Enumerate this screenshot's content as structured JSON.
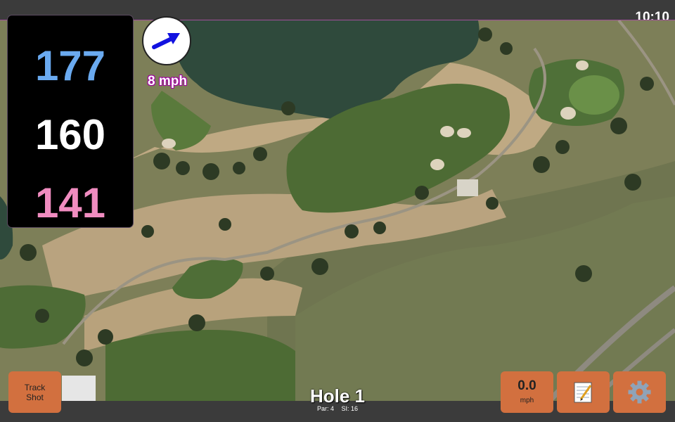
{
  "status": {
    "time": "10:10"
  },
  "yardages": {
    "back": "177",
    "middle": "160",
    "front": "141"
  },
  "wind": {
    "speed_label": "8 mph",
    "icon": "arrow-icon",
    "arrow_color": "#1212e0"
  },
  "buttons": {
    "track_shot_line1": "Track",
    "track_shot_line2": "Shot",
    "speed_value": "0.0",
    "speed_unit": "mph",
    "notes_icon": "notepad-icon",
    "settings_icon": "gear-icon"
  },
  "hole": {
    "title": "Hole 1",
    "par_label": "Par: 4",
    "si_label": "SI: 16"
  },
  "colors": {
    "button": "#d2703f",
    "back_yardage": "#6aaaf0",
    "middle_yardage": "#ffffff",
    "front_yardage": "#f08cc0",
    "water": "#2f4a3c",
    "fairway": "#4d6b34",
    "sand": "#c8b28f"
  }
}
